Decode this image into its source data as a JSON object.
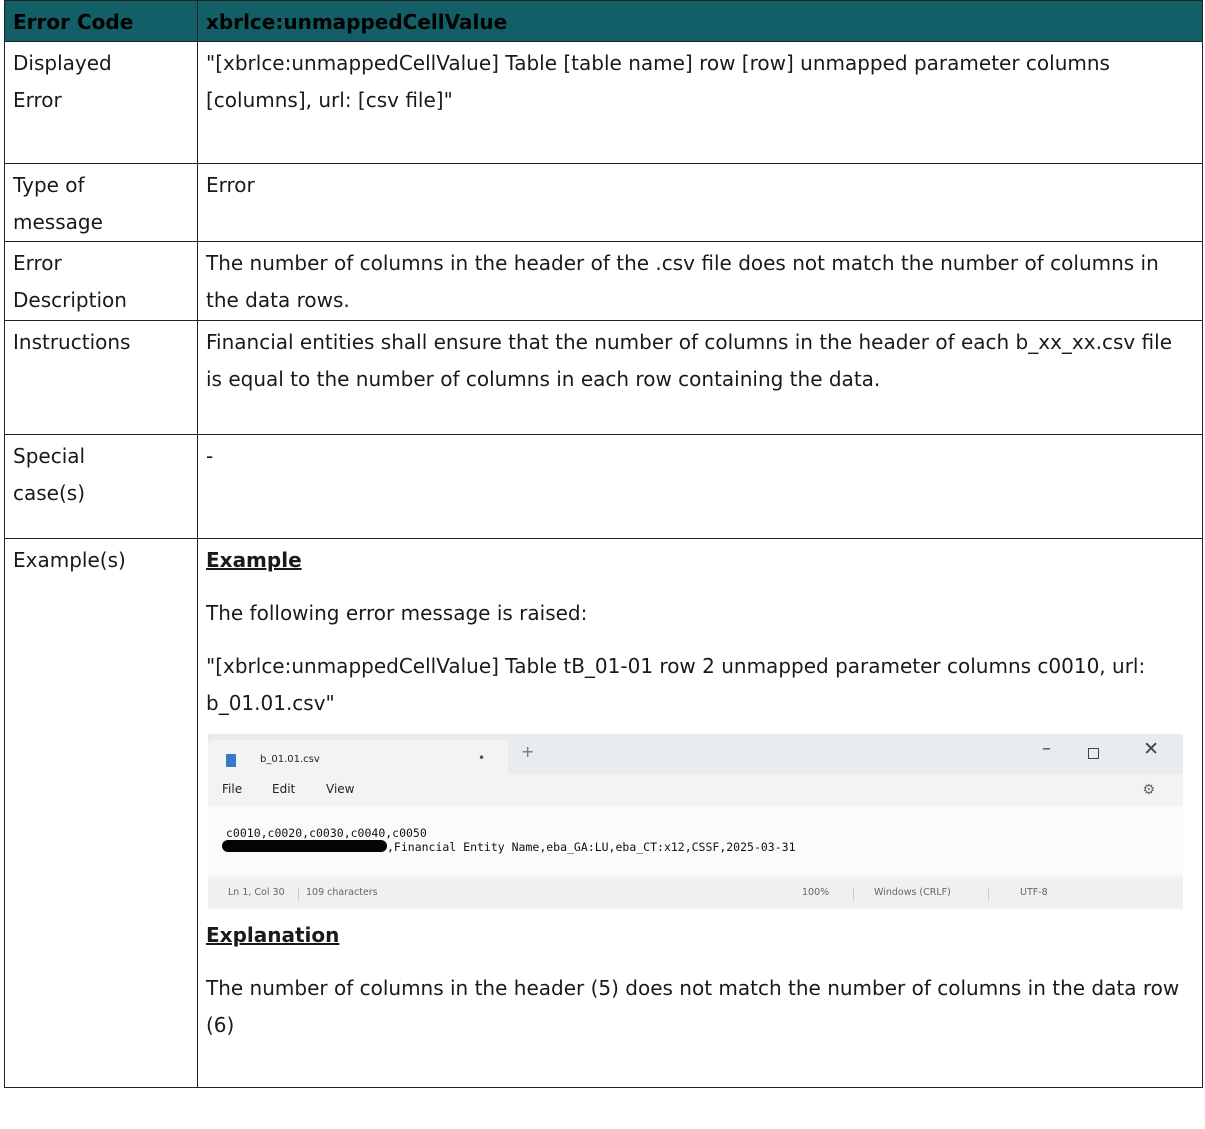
{
  "header": {
    "label": "Error Code",
    "value": "xbrlce:unmappedCellValue"
  },
  "rows": {
    "displayed_error": {
      "label_line1": "Displayed",
      "label_line2": "Error",
      "value": "\"[xbrlce:unmappedCellValue] Table [table name] row [row] unmapped parameter columns [columns], url: [csv file]\""
    },
    "type": {
      "label_line1": "Type of",
      "label_line2": "message",
      "value": "Error"
    },
    "description": {
      "label_line1": "Error",
      "label_line2": "Description",
      "value": "The number of columns in the header of the .csv file does not match the number of columns in the data rows."
    },
    "instructions": {
      "label": "Instructions",
      "value": "Financial entities shall ensure that the number of columns in the header of each b_xx_xx.csv file is equal to the number of columns in each row containing the data."
    },
    "special": {
      "label_line1": "Special",
      "label_line2": "case(s)",
      "value": "-"
    },
    "examples": {
      "label": "Example(s)",
      "example_title": "Example",
      "intro": "The following error message is raised:",
      "message": "\"[xbrlce:unmappedCellValue] Table tB_01-01 row 2 unmapped parameter columns c0010, url: b_01.01.csv\"",
      "explanation_title": "Explanation",
      "explanation": "The number of columns in the header (5) does not match the number of columns in the data row (6)"
    }
  },
  "notepad": {
    "tab_title": "b_01.01.csv",
    "tab_dot": "•",
    "new_tab": "+",
    "min": "–",
    "close": "✕",
    "gear": "⚙",
    "menu": [
      "File",
      "Edit",
      "View"
    ],
    "line1": "c0010,c0020,c0030,c0040,c0050",
    "line2": ",Financial Entity Name,eba_GA:LU,eba_CT:x12,CSSF,2025-03-31",
    "status": {
      "position": "Ln 1, Col 30",
      "chars": "109 characters",
      "zoom": "100%",
      "eol": "Windows (CRLF)",
      "encoding": "UTF-8"
    }
  }
}
